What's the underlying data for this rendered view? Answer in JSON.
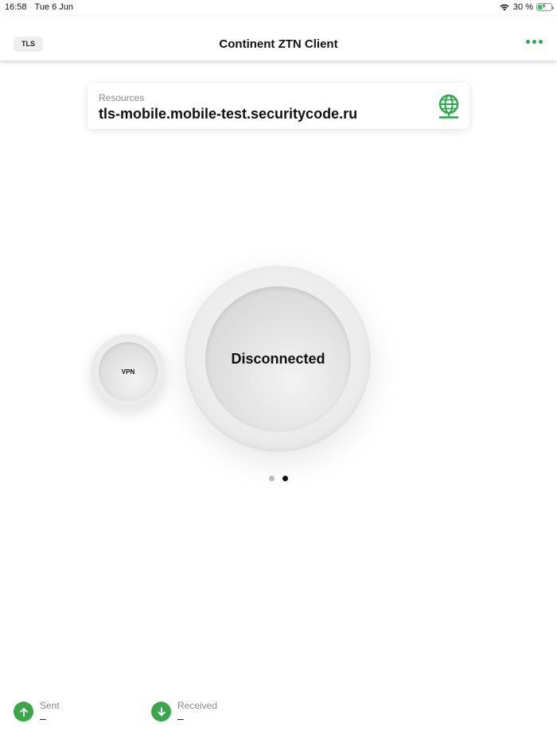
{
  "status_bar": {
    "time": "16:58",
    "date": "Tue 6 Jun",
    "battery_percent_label": "30 %",
    "battery_level": 0.3
  },
  "nav": {
    "profile_chip": "TLS",
    "title": "Continent ZTN Client",
    "more_icon": "ellipsis-icon"
  },
  "resources": {
    "label": "Resources",
    "value": "tls-mobile.mobile-test.securitycode.ru",
    "icon": "globe-icon"
  },
  "connection": {
    "main_status": "Disconnected",
    "secondary_label": "VPN"
  },
  "pager": {
    "pages": 2,
    "active_index": 1
  },
  "traffic": {
    "sent": {
      "label": "Sent",
      "value": "–",
      "icon": "arrow-up-icon"
    },
    "received": {
      "label": "Received",
      "value": "–",
      "icon": "arrow-down-icon"
    }
  },
  "colors": {
    "accent": "#2aa84a",
    "traffic_icon": "#3aa64a"
  }
}
